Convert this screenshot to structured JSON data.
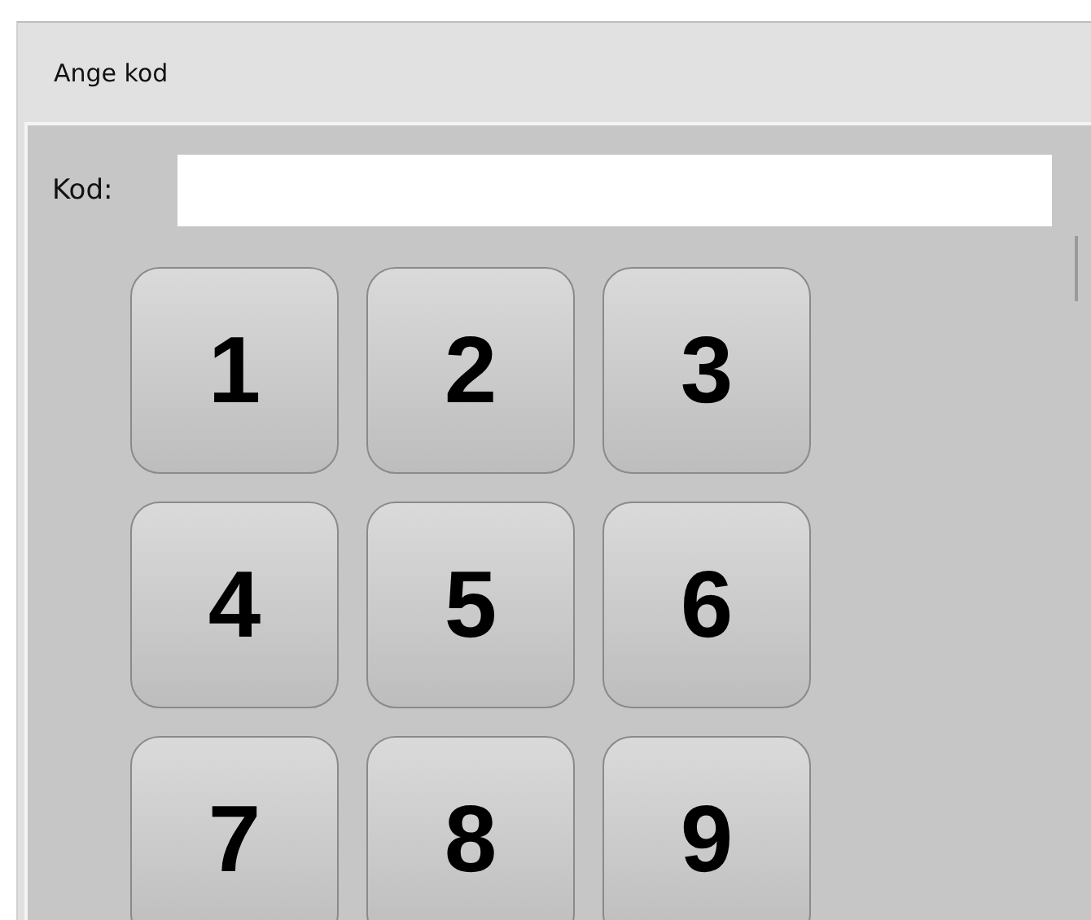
{
  "window": {
    "title": "Ange kod"
  },
  "code_field": {
    "label": "Kod:"
  },
  "keypad": [
    "1",
    "2",
    "3",
    "4",
    "5",
    "6",
    "7",
    "8",
    "9"
  ]
}
